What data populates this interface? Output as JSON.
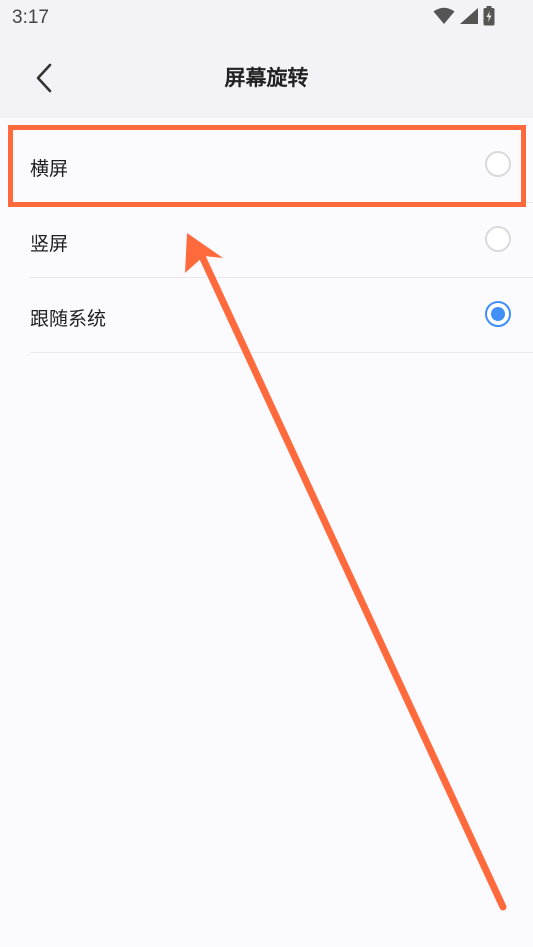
{
  "status_bar": {
    "time": "3:17",
    "icons": [
      "wifi-icon",
      "signal-icon",
      "battery-charging-icon"
    ]
  },
  "header": {
    "title": "屏幕旋转",
    "back_icon": "chevron-left-icon"
  },
  "options": [
    {
      "label": "横屏",
      "selected": false
    },
    {
      "label": "竖屏",
      "selected": false
    },
    {
      "label": "跟随系统",
      "selected": true
    }
  ],
  "colors": {
    "accent": "#3f8ff7",
    "annotation": "#ff6a3c",
    "header_bg": "#f3f2f7",
    "page_bg": "#fbfaff"
  }
}
